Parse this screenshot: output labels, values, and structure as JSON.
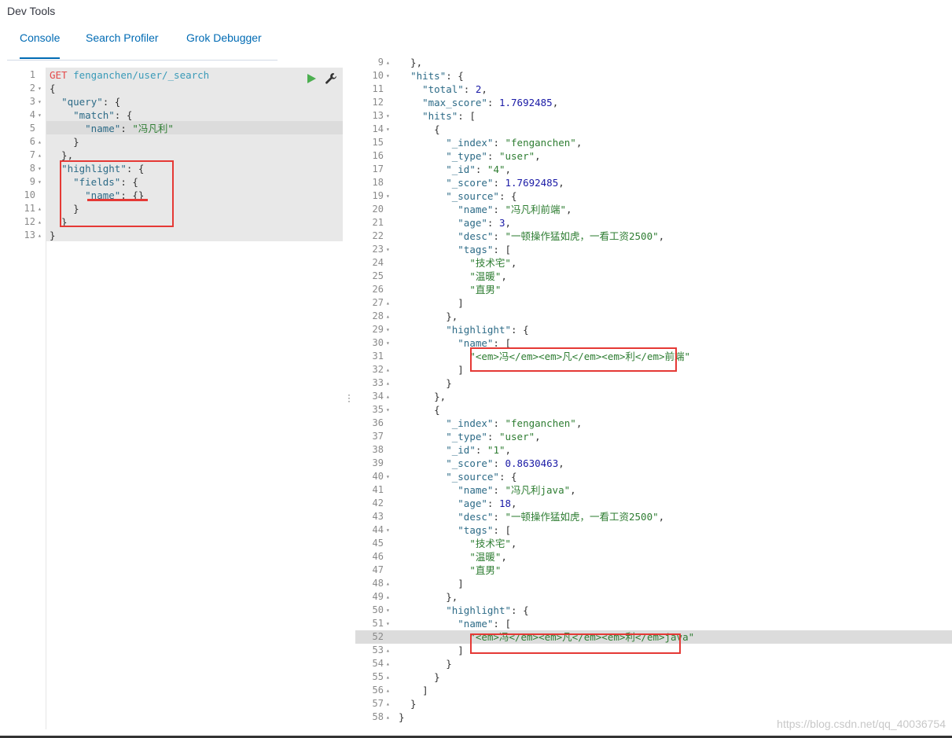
{
  "app": {
    "title": "Dev Tools"
  },
  "tabs": [
    {
      "label": "Console",
      "active": true
    },
    {
      "label": "Search Profiler",
      "active": false
    },
    {
      "label": "Grok Debugger",
      "active": false
    }
  ],
  "colors": {
    "accent": "#006bb4",
    "highlight_box": "#e53935"
  },
  "icons": {
    "run": "play-icon",
    "settings": "wrench-icon"
  },
  "watermark": "https://blog.csdn.net/qq_40036754",
  "request": {
    "method": "GET",
    "path": "fenganchen/user/_search",
    "active_line": 5,
    "lines": [
      {
        "n": "1",
        "fold": "",
        "t": "GET fenganchen/user/_search"
      },
      {
        "n": "2",
        "fold": "▾",
        "t": "{"
      },
      {
        "n": "3",
        "fold": "▾",
        "t": "  \"query\": {"
      },
      {
        "n": "4",
        "fold": "▾",
        "t": "    \"match\": {"
      },
      {
        "n": "5",
        "fold": "",
        "t": "      \"name\": \"冯凡利\""
      },
      {
        "n": "6",
        "fold": "▴",
        "t": "    }"
      },
      {
        "n": "7",
        "fold": "▴",
        "t": "  },"
      },
      {
        "n": "8",
        "fold": "▾",
        "t": "  \"highlight\": {"
      },
      {
        "n": "9",
        "fold": "▾",
        "t": "    \"fields\": {"
      },
      {
        "n": "10",
        "fold": "",
        "t": "      \"name\": {}"
      },
      {
        "n": "11",
        "fold": "▴",
        "t": "    }"
      },
      {
        "n": "12",
        "fold": "▴",
        "t": "  }"
      },
      {
        "n": "13",
        "fold": "▴",
        "t": "}"
      }
    ]
  },
  "response": {
    "active_line": 52,
    "lines": [
      {
        "n": "9",
        "fold": "▴",
        "t": "  },"
      },
      {
        "n": "10",
        "fold": "▾",
        "t": "  \"hits\": {"
      },
      {
        "n": "11",
        "fold": "",
        "t": "    \"total\": 2,"
      },
      {
        "n": "12",
        "fold": "",
        "t": "    \"max_score\": 1.7692485,"
      },
      {
        "n": "13",
        "fold": "▾",
        "t": "    \"hits\": ["
      },
      {
        "n": "14",
        "fold": "▾",
        "t": "      {"
      },
      {
        "n": "15",
        "fold": "",
        "t": "        \"_index\": \"fenganchen\","
      },
      {
        "n": "16",
        "fold": "",
        "t": "        \"_type\": \"user\","
      },
      {
        "n": "17",
        "fold": "",
        "t": "        \"_id\": \"4\","
      },
      {
        "n": "18",
        "fold": "",
        "t": "        \"_score\": 1.7692485,"
      },
      {
        "n": "19",
        "fold": "▾",
        "t": "        \"_source\": {"
      },
      {
        "n": "20",
        "fold": "",
        "t": "          \"name\": \"冯凡利前端\","
      },
      {
        "n": "21",
        "fold": "",
        "t": "          \"age\": 3,"
      },
      {
        "n": "22",
        "fold": "",
        "t": "          \"desc\": \"一顿操作猛如虎，一看工资2500\","
      },
      {
        "n": "23",
        "fold": "▾",
        "t": "          \"tags\": ["
      },
      {
        "n": "24",
        "fold": "",
        "t": "            \"技术宅\","
      },
      {
        "n": "25",
        "fold": "",
        "t": "            \"温暖\","
      },
      {
        "n": "26",
        "fold": "",
        "t": "            \"直男\""
      },
      {
        "n": "27",
        "fold": "▴",
        "t": "          ]"
      },
      {
        "n": "28",
        "fold": "▴",
        "t": "        },"
      },
      {
        "n": "29",
        "fold": "▾",
        "t": "        \"highlight\": {"
      },
      {
        "n": "30",
        "fold": "▾",
        "t": "          \"name\": ["
      },
      {
        "n": "31",
        "fold": "",
        "t": "            \"<em>冯</em><em>凡</em><em>利</em>前端\""
      },
      {
        "n": "32",
        "fold": "▴",
        "t": "          ]"
      },
      {
        "n": "33",
        "fold": "▴",
        "t": "        }"
      },
      {
        "n": "34",
        "fold": "▴",
        "t": "      },"
      },
      {
        "n": "35",
        "fold": "▾",
        "t": "      {"
      },
      {
        "n": "36",
        "fold": "",
        "t": "        \"_index\": \"fenganchen\","
      },
      {
        "n": "37",
        "fold": "",
        "t": "        \"_type\": \"user\","
      },
      {
        "n": "38",
        "fold": "",
        "t": "        \"_id\": \"1\","
      },
      {
        "n": "39",
        "fold": "",
        "t": "        \"_score\": 0.8630463,"
      },
      {
        "n": "40",
        "fold": "▾",
        "t": "        \"_source\": {"
      },
      {
        "n": "41",
        "fold": "",
        "t": "          \"name\": \"冯凡利java\","
      },
      {
        "n": "42",
        "fold": "",
        "t": "          \"age\": 18,"
      },
      {
        "n": "43",
        "fold": "",
        "t": "          \"desc\": \"一顿操作猛如虎，一看工资2500\","
      },
      {
        "n": "44",
        "fold": "▾",
        "t": "          \"tags\": ["
      },
      {
        "n": "45",
        "fold": "",
        "t": "            \"技术宅\","
      },
      {
        "n": "46",
        "fold": "",
        "t": "            \"温暖\","
      },
      {
        "n": "47",
        "fold": "",
        "t": "            \"直男\""
      },
      {
        "n": "48",
        "fold": "▴",
        "t": "          ]"
      },
      {
        "n": "49",
        "fold": "▴",
        "t": "        },"
      },
      {
        "n": "50",
        "fold": "▾",
        "t": "        \"highlight\": {"
      },
      {
        "n": "51",
        "fold": "▾",
        "t": "          \"name\": ["
      },
      {
        "n": "52",
        "fold": "",
        "t": "            \"<em>冯</em><em>凡</em><em>利</em>java\""
      },
      {
        "n": "53",
        "fold": "▴",
        "t": "          ]"
      },
      {
        "n": "54",
        "fold": "▴",
        "t": "        }"
      },
      {
        "n": "55",
        "fold": "▴",
        "t": "      }"
      },
      {
        "n": "56",
        "fold": "▴",
        "t": "    ]"
      },
      {
        "n": "57",
        "fold": "▴",
        "t": "  }"
      },
      {
        "n": "58",
        "fold": "▴",
        "t": "}"
      }
    ]
  }
}
